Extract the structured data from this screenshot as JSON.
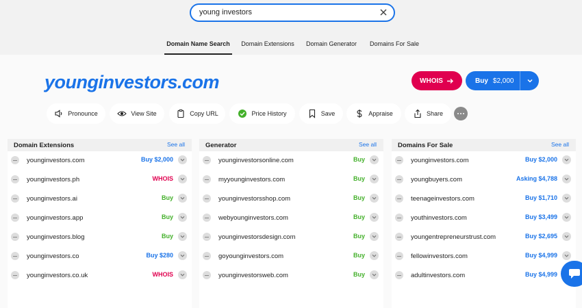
{
  "search": {
    "value": "young investors"
  },
  "tabs": [
    {
      "label": "Domain Name Search",
      "active": true
    },
    {
      "label": "Domain Extensions"
    },
    {
      "label": "Domain Generator"
    },
    {
      "label": "Domains For Sale"
    }
  ],
  "domain": {
    "name": "younginvestors.com",
    "whois_label": "WHOIS",
    "buy_label": "Buy",
    "buy_price": "$2,000"
  },
  "actions": {
    "pronounce": "Pronounce",
    "view_site": "View Site",
    "copy_url": "Copy URL",
    "price_history": "Price History",
    "save": "Save",
    "appraise": "Appraise",
    "share": "Share"
  },
  "panels": [
    {
      "title": "Domain Extensions",
      "see_all": "See all",
      "rows": [
        {
          "name": "younginvestors.com",
          "action": "Buy $2,000",
          "kind": "blue"
        },
        {
          "name": "younginvestors.ph",
          "action": "WHOIS",
          "kind": "red"
        },
        {
          "name": "younginvestors.ai",
          "action": "Buy",
          "kind": "green"
        },
        {
          "name": "younginvestors.app",
          "action": "Buy",
          "kind": "green"
        },
        {
          "name": "younginvestors.blog",
          "action": "Buy",
          "kind": "green"
        },
        {
          "name": "younginvestors.co",
          "action": "Buy $280",
          "kind": "blue"
        },
        {
          "name": "younginvestors.co.uk",
          "action": "WHOIS",
          "kind": "red"
        }
      ]
    },
    {
      "title": "Generator",
      "see_all": "See all",
      "rows": [
        {
          "name": "younginvestorsonline.com",
          "action": "Buy",
          "kind": "green"
        },
        {
          "name": "myyounginvestors.com",
          "action": "Buy",
          "kind": "green"
        },
        {
          "name": "younginvestorsshop.com",
          "action": "Buy",
          "kind": "green"
        },
        {
          "name": "webyounginvestors.com",
          "action": "Buy",
          "kind": "green"
        },
        {
          "name": "younginvestorsdesign.com",
          "action": "Buy",
          "kind": "green"
        },
        {
          "name": "goyounginvestors.com",
          "action": "Buy",
          "kind": "green"
        },
        {
          "name": "younginvestorsweb.com",
          "action": "Buy",
          "kind": "green"
        }
      ]
    },
    {
      "title": "Domains For Sale",
      "see_all": "See all",
      "rows": [
        {
          "name": "younginvestors.com",
          "action": "Buy $2,000",
          "kind": "blue"
        },
        {
          "name": "youngbuyers.com",
          "action": "Asking $4,788",
          "kind": "blue"
        },
        {
          "name": "teenageinvestors.com",
          "action": "Buy $1,710",
          "kind": "blue"
        },
        {
          "name": "youthinvestors.com",
          "action": "Buy $3,499",
          "kind": "blue"
        },
        {
          "name": "youngentrepreneurstrust.com",
          "action": "Buy $2,695",
          "kind": "blue"
        },
        {
          "name": "fellowinvestors.com",
          "action": "Buy $4,999",
          "kind": "blue"
        },
        {
          "name": "adultinvestors.com",
          "action": "Buy $4,999",
          "kind": "blue"
        }
      ]
    }
  ],
  "colors": {
    "accent": "#1a73e8",
    "whois": "#e0004f",
    "buy_green": "#43b02a"
  },
  "icons": [
    "clear-icon",
    "arrow-right-icon",
    "chevron-down-icon",
    "speaker-icon",
    "eye-icon",
    "clipboard-icon",
    "check-badge-icon",
    "bookmark-icon",
    "dollar-icon",
    "share-icon",
    "more-icon",
    "minus-icon",
    "chat-icon"
  ]
}
